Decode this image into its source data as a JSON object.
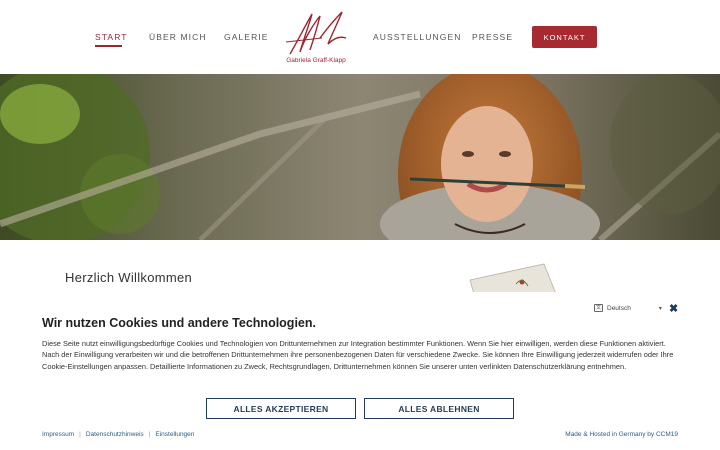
{
  "nav": {
    "start": "START",
    "ueber_mich": "ÜBER MICH",
    "galerie": "GALERIE",
    "ausstellungen": "AUSSTELLUNGEN",
    "presse": "PRESSE",
    "kontakt": "KONTAKT"
  },
  "logo": {
    "name": "Gabriela Graff-Klapp"
  },
  "content": {
    "welcome": "Herzlich Willkommen"
  },
  "cookie": {
    "title": "Wir nutzen Cookies und andere Technologien.",
    "text": "Diese Seite nutzt einwilligungsbedürftige Cookies und Technologien von Drittunternehmen zur Integration bestimmter Funktionen. Wenn Sie hier einwilligen, werden diese Funktionen aktiviert. Nach der Einwilligung verarbeiten wir und die betroffenen Drittunternehmen ihre personenbezogenen Daten für verschiedene Zwecke. Sie können Ihre Einwilligung jederzeit widerrufen oder Ihre Cookie-Einstellungen anpassen. Detaillierte Informationen zu Zweck, Rechtsgrundlagen, Drittunternehmen können Sie unserer unten verlinkten Datenschutzerklärung entnehmen.",
    "language": "Deutsch",
    "accept": "ALLES AKZEPTIEREN",
    "reject": "ALLES ABLEHNEN",
    "links": {
      "impressum": "Impressum",
      "datenschutz": "Datenschutzhinweis",
      "einstellungen": "Einstellungen"
    },
    "hosted": "Made & Hosted in Germany by CCM19"
  },
  "colors": {
    "accent": "#a82a31",
    "banner_accent": "#1f3c5a"
  }
}
